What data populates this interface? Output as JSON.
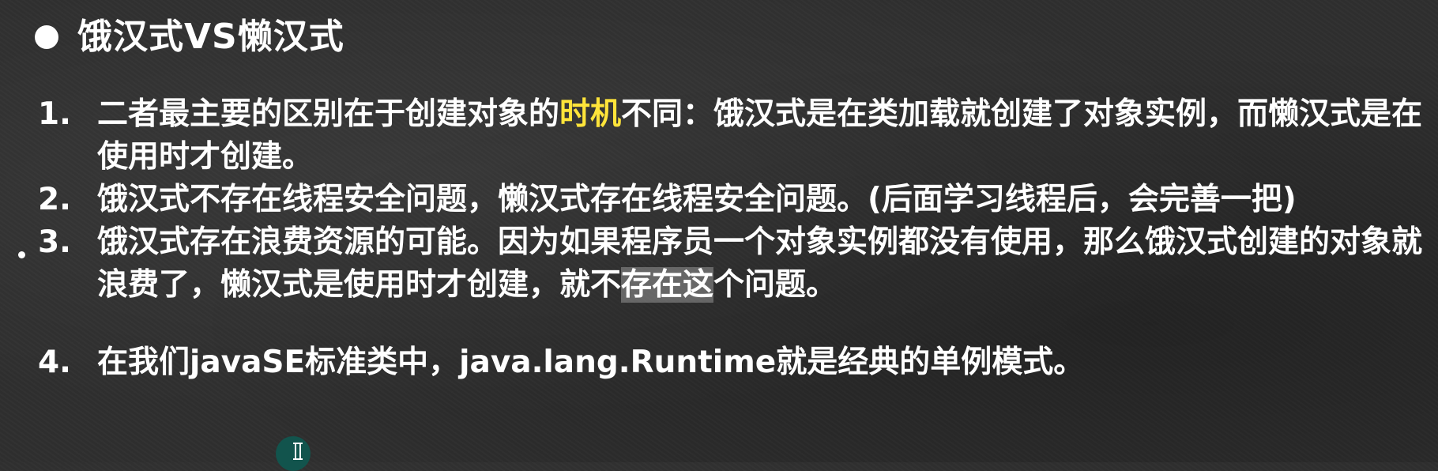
{
  "slide": {
    "title": "饿汉式VS懒汉式",
    "items": [
      {
        "number": "1.",
        "text_before": "二者最主要的区别在于创建对象的",
        "highlight": "时机",
        "text_after": "不同：饿汉式是在类加载就创建了对象实例，而懒汉式是在使用时才创建。"
      },
      {
        "number": "2.",
        "text": "饿汉式不存在线程安全问题，懒汉式存在线程安全问题。(后面学习线程后，会完善一把)"
      },
      {
        "number": "3.",
        "text_before": "饿汉式存在浪费资源的可能。因为如果程序员一个对象实例都没有使用，那么饿汉式创建的对象就浪费了，懒汉式是使用时才创建，就不",
        "selected": "存在这",
        "text_after": "个问题。"
      },
      {
        "number": "4.",
        "text": "在我们javaSE标准类中，java.lang.Runtime就是经典的单例模式。"
      }
    ]
  },
  "colors": {
    "background": "#2f2f2f",
    "text": "#ffffff",
    "highlight": "#ffe43a",
    "selection": "#8a8a8a",
    "cursor_ring": "#0d5a52"
  },
  "icons": {
    "title_bullet": "bullet-dot-icon",
    "side_marker": "side-dot-icon",
    "cursor": "text-cursor-icon"
  }
}
